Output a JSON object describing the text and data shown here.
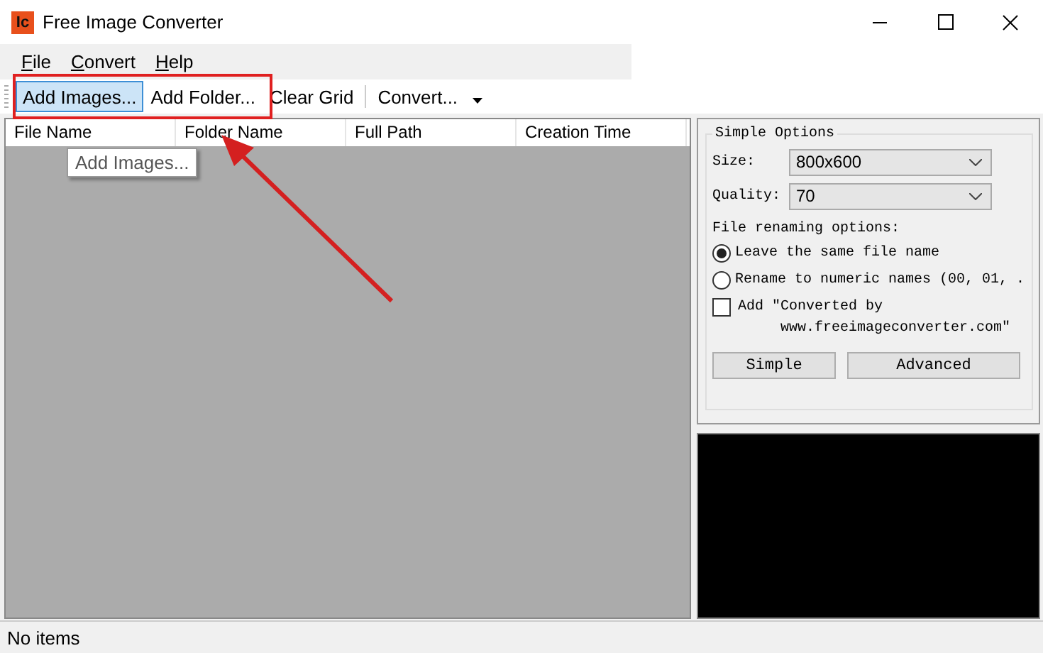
{
  "window": {
    "title": "Free Image Converter",
    "app_icon": "Ic"
  },
  "menu": [
    {
      "label": "File"
    },
    {
      "label": "Convert"
    },
    {
      "label": "Help"
    }
  ],
  "toolbar": [
    {
      "kind": "button",
      "label": "Add Images...",
      "selected": true
    },
    {
      "kind": "button",
      "label": "Add Folder...",
      "selected": false
    },
    {
      "kind": "button",
      "label": "Clear Grid",
      "selected": false
    },
    {
      "kind": "separator"
    },
    {
      "kind": "dropdown",
      "label": "Convert...",
      "selected": false
    }
  ],
  "grid": {
    "columns": [
      "File Name",
      "Folder Name",
      "Full Path",
      "Creation Time"
    ]
  },
  "tooltip": "Add Images...",
  "options": {
    "title": "Simple Options",
    "size": {
      "label": "Size:",
      "value": "800x600"
    },
    "quality": {
      "label": "Quality:",
      "value": "70"
    },
    "renaming_label": "File renaming options:",
    "renaming": [
      {
        "label": "Leave the same file name",
        "selected": true
      },
      {
        "label": "Rename to numeric names (00, 01, .",
        "selected": false
      }
    ],
    "credit": {
      "label": "Add \"Converted by",
      "continuation": "www.freeimageconverter.com\"",
      "checked": false
    },
    "buttons": [
      "Simple",
      "Advanced"
    ]
  },
  "status_bar": "No items"
}
